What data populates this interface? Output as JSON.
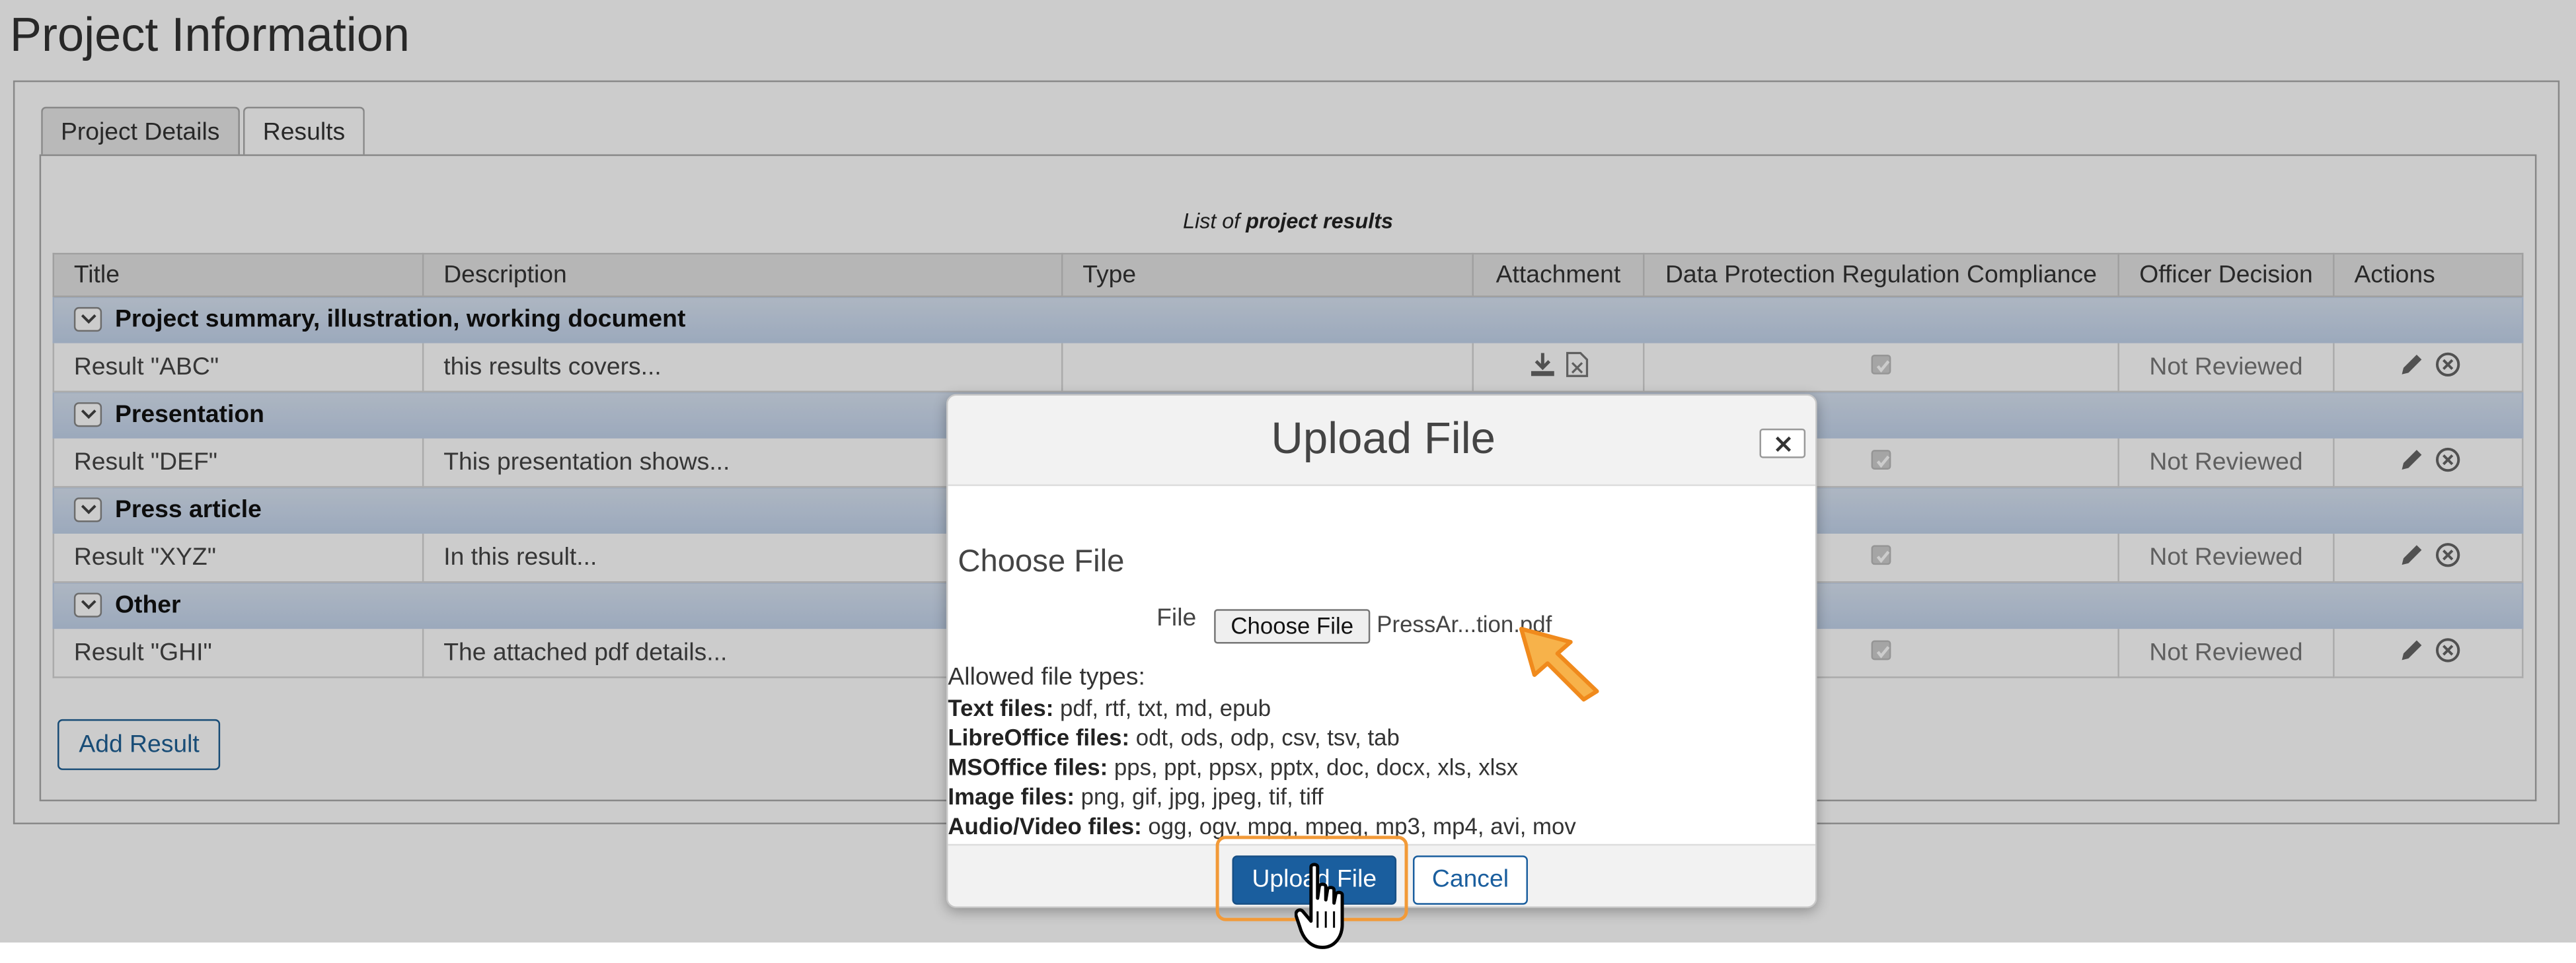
{
  "page": {
    "title": "Project Information"
  },
  "tabs": [
    {
      "label": "Project Details",
      "active": false
    },
    {
      "label": "Results",
      "active": true
    }
  ],
  "list": {
    "caption_prefix": "List of",
    "caption_bold": "project results"
  },
  "table": {
    "headers": [
      "Title",
      "Description",
      "Type",
      "Attachment",
      "Data Protection Regulation Compliance",
      "Officer Decision",
      "Actions"
    ],
    "groups": [
      {
        "label": "Project summary, illustration, working document",
        "row": {
          "title": "Result \"ABC\"",
          "description": "this results covers...",
          "type": "",
          "decision": "Not Reviewed"
        }
      },
      {
        "label": "Presentation",
        "row": {
          "title": "Result \"DEF\"",
          "description": "This presentation shows...",
          "type": "",
          "decision": "Not Reviewed"
        }
      },
      {
        "label": "Press article",
        "row": {
          "title": "Result \"XYZ\"",
          "description": "In this result...",
          "type": "",
          "decision": "Not Reviewed"
        }
      },
      {
        "label": "Other",
        "row": {
          "title": "Result \"GHI\"",
          "description": "The attached pdf details...",
          "type": "",
          "decision": "Not Reviewed"
        }
      }
    ]
  },
  "add_button": "Add Result",
  "modal": {
    "title": "Upload File",
    "section_title": "Choose File",
    "file_label": "File",
    "choose_button": "Choose File",
    "file_name": "PressAr...tion.pdf",
    "allowed_heading": "Allowed file types:",
    "types": [
      {
        "label": "Text files:",
        "values": "pdf, rtf, txt, md, epub"
      },
      {
        "label": "LibreOffice files:",
        "values": "odt, ods, odp, csv, tsv, tab"
      },
      {
        "label": "MSOffice files:",
        "values": "pps, ppt, ppsx, pptx, doc, docx, xls, xlsx"
      },
      {
        "label": "Image files:",
        "values": "png, gif, jpg, jpeg, tif, tiff"
      },
      {
        "label": "Audio/Video files:",
        "values": "ogg, ogv, mpg, mpeg, mp3, mp4, avi, mov"
      }
    ],
    "upload_button": "Upload File",
    "cancel_button": "Cancel"
  },
  "colors": {
    "primary": "#1a5e9e",
    "group_row": "#c8d8ee",
    "highlight": "#f29a38",
    "overlay": "rgba(0,0,0,0.2)"
  },
  "icons": [
    "chevron-down-icon",
    "download-icon",
    "file-delete-icon",
    "checkbox-icon",
    "pencil-icon",
    "remove-circle-icon",
    "close-icon",
    "hand-cursor-icon",
    "arrow-pointer-icon"
  ]
}
